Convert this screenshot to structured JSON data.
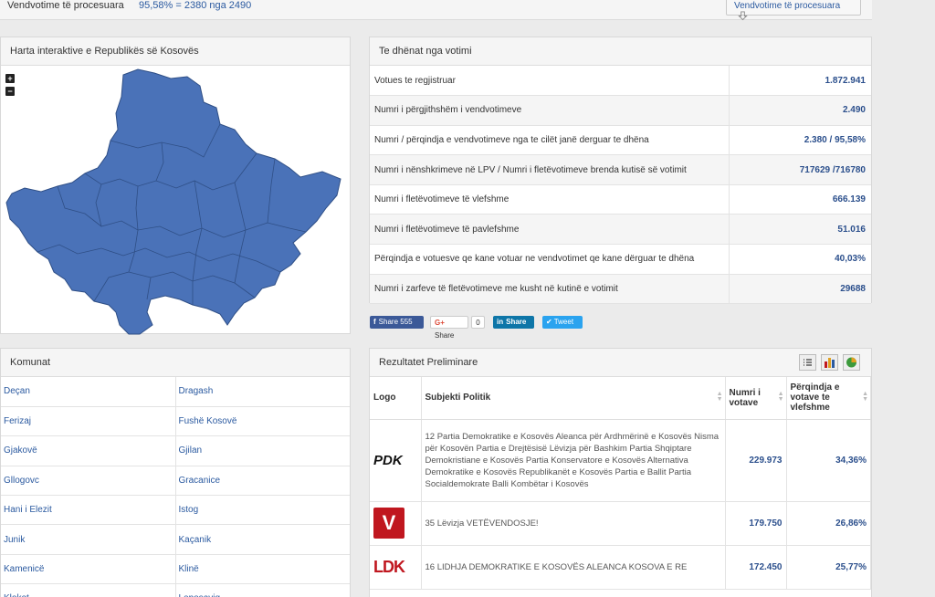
{
  "topbar": {
    "label": "Vendvotime të procesuara",
    "value": "95,58% = 2380 nga 2490",
    "button_label": "Vendvotime të procesuara"
  },
  "map_panel": {
    "title": "Harta interaktive e Republikës së Kosovës",
    "zoom_in": "+",
    "zoom_out": "−",
    "map_color": "#4a72b8"
  },
  "data_panel": {
    "title": "Te dhënat nga votimi",
    "rows": [
      {
        "label": "Votues te regjistruar",
        "value": "1.872.941"
      },
      {
        "label": "Numri i përgjithshëm i vendvotimeve",
        "value": "2.490"
      },
      {
        "label": "Numri / përqindja e vendvotimeve nga te cilët janë derguar te dhëna",
        "value": "2.380 / 95,58%"
      },
      {
        "label": "Numri i nënshkrimeve në LPV / Numri i fletëvotimeve brenda kutisë së votimit",
        "value": "717629 /716780"
      },
      {
        "label": "Numri i fletëvotimeve të vlefshme",
        "value": "666.139"
      },
      {
        "label": "Numri i fletëvotimeve të pavlefshme",
        "value": "51.016"
      },
      {
        "label": "Përqindja e votuesve qe kane votuar ne vendvotimet qe kane dërguar te dhëna",
        "value": "40,03%"
      },
      {
        "label": "Numri i zarfeve të fletëvotimeve me kusht në kutinë e votimit",
        "value": "29688"
      }
    ]
  },
  "share": {
    "facebook": "Share 555",
    "google": "Share",
    "google_count": "0",
    "linkedin": "Share",
    "twitter": "Tweet"
  },
  "komunat": {
    "title": "Komunat",
    "rows": [
      [
        "Deçan",
        "Dragash"
      ],
      [
        "Ferizaj",
        "Fushë Kosovë"
      ],
      [
        "Gjakovë",
        "Gjilan"
      ],
      [
        "Gllogovc",
        "Gracanice"
      ],
      [
        "Hani i Elezit",
        "Istog"
      ],
      [
        "Junik",
        "Kaçanik"
      ],
      [
        "Kamenicë",
        "Klinë"
      ],
      [
        "Klokot",
        "Leposaviq"
      ]
    ]
  },
  "results": {
    "title": "Rezultatet Preliminare",
    "headers": {
      "logo": "Logo",
      "subject": "Subjekti Politik",
      "votes": "Numri i votave",
      "percent": "Përqindja e votave te vlefshme"
    },
    "rows": [
      {
        "logo": "PDK",
        "subject": "12 Partia Demokratike e Kosovës Aleanca për Ardhmërinë e Kosovës Nisma për Kosovën Partia e Drejtësisë Lëvizja për Bashkim Partia Shqiptare Demokristiane e Kosovës Partia Konservatore e Kosovës Alternativa Demokratike e Kosovës Republikanët e Kosovës Partia e Ballit Partia Socialdemokrate Balli Kombëtar i Kosovës",
        "votes": "229.973",
        "percent": "34,36%"
      },
      {
        "logo": "V",
        "subject": "35 Lëvizja VETËVENDOSJE!",
        "votes": "179.750",
        "percent": "26,86%"
      },
      {
        "logo": "LDK",
        "subject": "16 LIDHJA DEMOKRATIKE E KOSOVËS ALEANCA KOSOVA E RE",
        "votes": "172.450",
        "percent": "25,77%"
      }
    ]
  }
}
